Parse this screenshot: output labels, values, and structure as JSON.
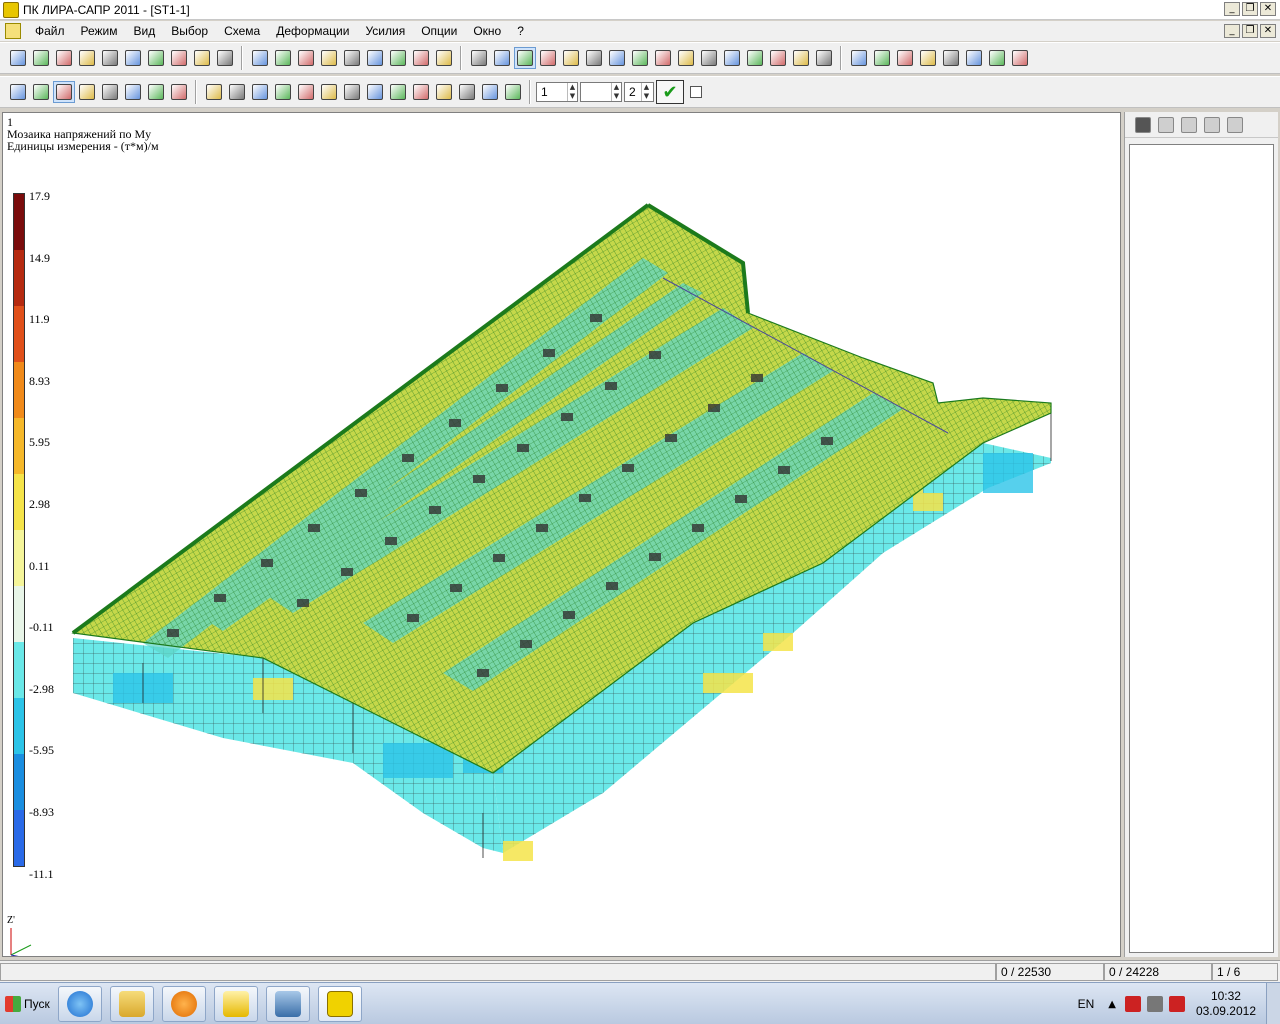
{
  "window": {
    "title": "ПК ЛИРА-САПР  2011 - [ST1-1]",
    "minimize": "_",
    "restore": "❐",
    "close": "✕"
  },
  "menu": {
    "items": [
      "Файл",
      "Режим",
      "Вид",
      "Выбор",
      "Схема",
      "Деформации",
      "Усилия",
      "Опции",
      "Окно",
      "?"
    ]
  },
  "toolbar2": {
    "load_case": "1",
    "spin2": "",
    "spin3": "2",
    "apply_label": "✔"
  },
  "viewport": {
    "info_line1": "1",
    "info_line2": "Мозаика напряжений по My",
    "info_line3": "Единицы измерения - (т*м)/м",
    "axis_label": "Z'"
  },
  "legend": {
    "labels": [
      "17.9",
      "14.9",
      "11.9",
      "8.93",
      "5.95",
      "2.98",
      "0.11",
      "-0.11",
      "-2.98",
      "-5.95",
      "-8.93",
      "-11.1"
    ],
    "colors": [
      "#7a0c0c",
      "#b52a10",
      "#e0501a",
      "#f08a1a",
      "#f5b82a",
      "#f5e44a",
      "#f5f59a",
      "#e8f5e8",
      "#6ae8e8",
      "#2cc4e8",
      "#1a8ee0",
      "#2a6ae8"
    ]
  },
  "statusbar": {
    "cell1": "",
    "cell2": "0 / 22530",
    "cell3": "0 / 24228",
    "cell4": "1 / 6"
  },
  "taskbar": {
    "start_label": "Пуск",
    "lang": "EN",
    "time": "10:32",
    "date": "03.09.2012"
  }
}
